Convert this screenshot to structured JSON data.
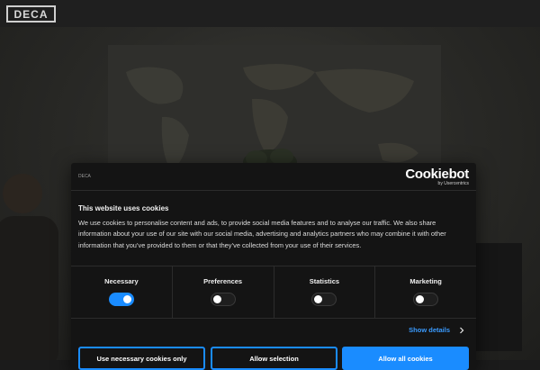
{
  "header": {
    "logo_text": "DECA"
  },
  "dialog": {
    "small_logo_text": "DECA",
    "brand": {
      "name": "Cookiebot",
      "sub": "by Usercentrics"
    },
    "title": "This website uses cookies",
    "body": "We use cookies to personalise content and ads, to provide social media features and to analyse our traffic. We also share information about your use of our site with our social media, advertising and analytics partners who may combine it with other information that you’ve provided to them or that they’ve collected from your use of their services.",
    "categories": [
      {
        "label": "Necessary",
        "enabled": true
      },
      {
        "label": "Preferences",
        "enabled": false
      },
      {
        "label": "Statistics",
        "enabled": false
      },
      {
        "label": "Marketing",
        "enabled": false
      }
    ],
    "show_details": "Show details",
    "buttons": {
      "necessary_only": "Use necessary cookies only",
      "allow_selection": "Allow selection",
      "allow_all": "Allow all cookies"
    }
  },
  "colors": {
    "accent": "#1a8cff",
    "dialog_bg": "#141414"
  }
}
